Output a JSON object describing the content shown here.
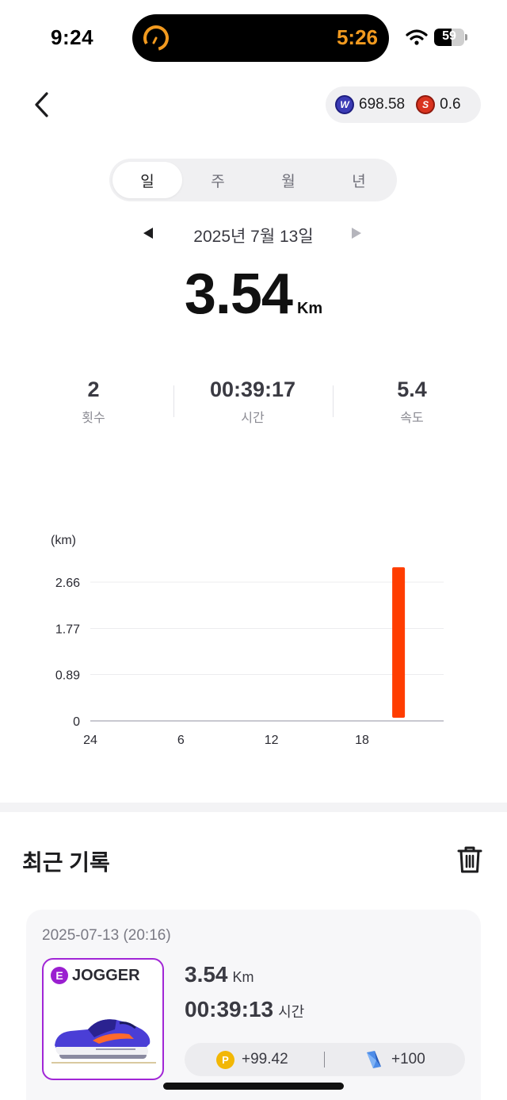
{
  "status_bar": {
    "time": "9:24",
    "island_timer": "5:26",
    "battery_level": "59",
    "battery_fraction": 0.59
  },
  "header": {
    "back_icon": "chevron-left-icon",
    "balances": [
      {
        "icon": "w-coin-icon",
        "letter": "W",
        "value": "698.58",
        "color": "#3b3bb5"
      },
      {
        "icon": "s-coin-icon",
        "letter": "S",
        "value": "0.6",
        "color": "#d9331f"
      }
    ]
  },
  "period_tabs": [
    {
      "label": "일",
      "active": true
    },
    {
      "label": "주",
      "active": false
    },
    {
      "label": "월",
      "active": false
    },
    {
      "label": "년",
      "active": false
    }
  ],
  "date_nav": {
    "label": "2025년 7월 13일"
  },
  "summary": {
    "distance": "3.54",
    "unit": "Km"
  },
  "stats": [
    {
      "value": "2",
      "label": "횟수"
    },
    {
      "value": "00:39:17",
      "label": "시간"
    },
    {
      "value": "5.4",
      "label": "속도"
    }
  ],
  "chart_data": {
    "type": "bar",
    "title": "",
    "xlabel": "",
    "ylabel": "(km)",
    "yticks": [
      "2.66",
      "1.77",
      "0.89",
      "0"
    ],
    "ytick_values": [
      2.66,
      1.77,
      0.89,
      0
    ],
    "ylim": [
      0,
      3.1
    ],
    "xticks": [
      "24",
      "6",
      "12",
      "18"
    ],
    "xtick_hours": [
      0,
      6,
      12,
      18
    ],
    "xlim": [
      0,
      23.4
    ],
    "grid": true,
    "bar_color": "#ff3d00",
    "bars": [
      {
        "hour": 20,
        "value": 3.54
      }
    ]
  },
  "recent": {
    "title": "최근 기록",
    "trash_icon": "trash-icon",
    "records": [
      {
        "date": "2025-07-13 (20:16)",
        "grade": "E",
        "shoe_type": "JOGGER",
        "distance": "3.54",
        "distance_unit": "Km",
        "time": "00:39:13",
        "time_unit": "시간",
        "points": "+99.42",
        "exp": "+100"
      }
    ]
  },
  "colors": {
    "accent_orange": "#f29a1f",
    "bar_red": "#ff3d00",
    "grade_purple": "#9a1fd0"
  }
}
